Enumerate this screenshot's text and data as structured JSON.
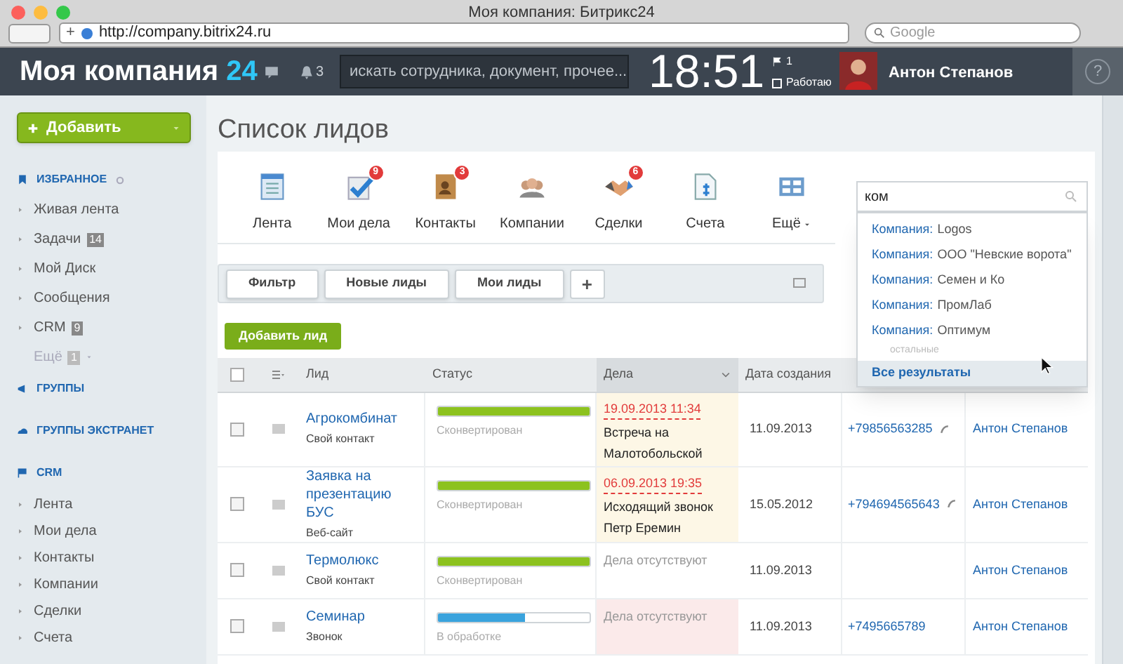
{
  "window": {
    "title": "Моя компания: Битрикс24"
  },
  "browser": {
    "new_tab": "+",
    "url": "http://company.bitrix24.ru",
    "search_placeholder": "Google"
  },
  "header": {
    "logo": "Моя компания",
    "logo_suffix": "24",
    "notifications": "3",
    "search_placeholder": "искать сотрудника, документ, прочее...",
    "time": "18:51",
    "flag_count": "1",
    "work_status": "Работаю",
    "user": "Антон Степанов",
    "help": "?"
  },
  "sidebar": {
    "add_button": "Добавить",
    "sections": [
      {
        "title": "ИЗБРАННОЕ",
        "kind": "favorites",
        "items": [
          {
            "label": "Живая лента"
          },
          {
            "label": "Задачи",
            "badge": "14"
          },
          {
            "label": "Мой Диск"
          },
          {
            "label": "Сообщения"
          },
          {
            "label": "CRM",
            "badge": "9"
          },
          {
            "label": "Ещё",
            "badge": "1",
            "kind": "more"
          }
        ]
      },
      {
        "title": "ГРУППЫ",
        "kind": "groups"
      },
      {
        "title": "ГРУППЫ ЭКСТРАНЕТ",
        "kind": "extranet"
      },
      {
        "title": "CRM",
        "kind": "crm",
        "items": [
          {
            "label": "Лента"
          },
          {
            "label": "Мои дела"
          },
          {
            "label": "Контакты"
          },
          {
            "label": "Компании"
          },
          {
            "label": "Сделки"
          },
          {
            "label": "Счета"
          }
        ]
      }
    ]
  },
  "page_title": "Список лидов",
  "toolbar": [
    {
      "label": "Лента",
      "kind": "feed"
    },
    {
      "label": "Мои дела",
      "kind": "tasks",
      "badge": "9"
    },
    {
      "label": "Контакты",
      "kind": "contacts",
      "badge": "3"
    },
    {
      "label": "Компании",
      "kind": "companies"
    },
    {
      "label": "Сделки",
      "kind": "deals",
      "badge": "6"
    },
    {
      "label": "Счета",
      "kind": "invoices"
    },
    {
      "label": "Ещё",
      "kind": "more"
    }
  ],
  "search": {
    "value": "ком",
    "results": [
      {
        "prefix": "Компания:",
        "name": "Logos"
      },
      {
        "prefix": "Компания:",
        "name": "ООО \"Невские ворота\""
      },
      {
        "prefix": "Компания:",
        "name": "Семен и Ко"
      },
      {
        "prefix": "Компания:",
        "name": "ПромЛаб"
      },
      {
        "prefix": "Компания:",
        "name": "Оптимум"
      }
    ],
    "section_label": "остальные",
    "all_results": "Все результаты"
  },
  "filters": [
    {
      "label": "Фильтр"
    },
    {
      "label": "Новые лиды"
    },
    {
      "label": "Мои лиды"
    }
  ],
  "add_filter": "+",
  "add_lead": "Добавить лид",
  "table": {
    "all_checked": false,
    "columns": [
      {
        "label": "Лид",
        "sorted": false
      },
      {
        "label": "Статус",
        "sorted": false
      },
      {
        "label": "Дела",
        "sorted": true
      },
      {
        "label": "Дата создания",
        "sorted": false
      }
    ],
    "rows": [
      {
        "checked": false,
        "title": "Агрокомбинат",
        "source": "Свой контакт",
        "status": "Сконвертирован",
        "level": 1,
        "color": "#8cc21f",
        "activity": {
          "kind": "scheduled",
          "date": "19.09.2013 11:34",
          "text": "Встреча на Малотобольской"
        },
        "created": "11.09.2013",
        "phone": "+79856563285",
        "owner": "Антон Степанов"
      },
      {
        "checked": false,
        "title": "Заявка на презентацию БУС",
        "source": "Веб-сайт",
        "status": "Сконвертирован",
        "level": 1,
        "color": "#8cc21f",
        "activity": {
          "kind": "scheduled",
          "date": "06.09.2013 19:35",
          "text": "Исходящий звонок Петр Еремин"
        },
        "created": "15.05.2012",
        "phone": "+794694565643",
        "owner": "Антон Степанов"
      },
      {
        "checked": false,
        "title": "Термолюкс",
        "source": "Свой контакт",
        "status": "Сконвертирован",
        "level": 1,
        "color": "#8cc21f",
        "activity": {
          "kind": "none",
          "text": "Дела отсутствуют"
        },
        "created": "11.09.2013",
        "owner": "Антон Степанов"
      },
      {
        "checked": false,
        "title": "Семинар",
        "source": "Звонок",
        "status": "В обработке",
        "level": 0.57,
        "color": "#3aa3dd",
        "activity": {
          "kind": "alert",
          "text": "Дела отсутствуют"
        },
        "created": "11.09.2013",
        "phone": "+7495665789",
        "owner": "Антон Степанов"
      }
    ]
  }
}
